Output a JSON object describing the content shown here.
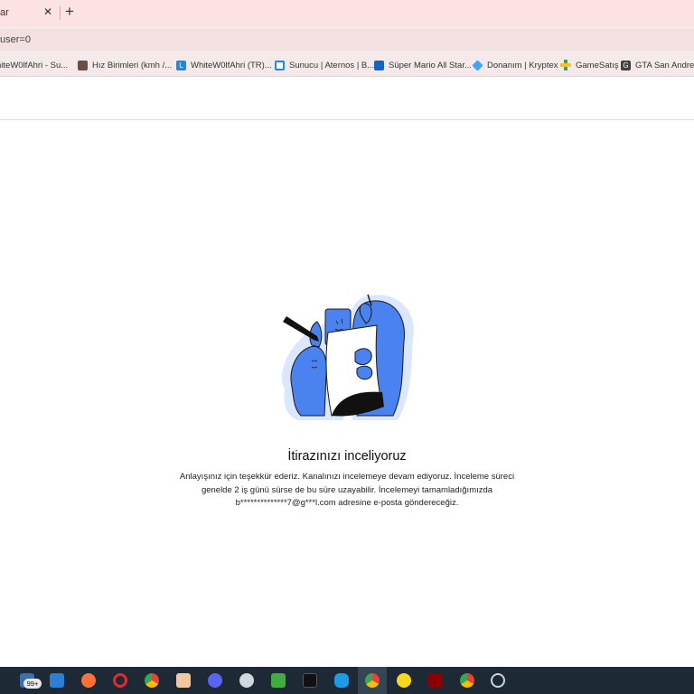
{
  "browser": {
    "tab_title": "ar",
    "tab_close": "✕",
    "new_tab": "+",
    "url": "user=0"
  },
  "bookmarks": [
    {
      "label": "hiteW0lfAhri - Su...",
      "color": "#c62828"
    },
    {
      "label": "Hız Birimleri (kmh /...",
      "color": "#6d4c41"
    },
    {
      "label": "WhiteW0lfAhri (TR)...",
      "color": "#1e88e5",
      "glyph": "L"
    },
    {
      "label": "Sunucu | Aternos | B...",
      "color": "#1e88e5"
    },
    {
      "label": "Süper Mario All Star...",
      "color": "#1565c0"
    },
    {
      "label": "Donanım | Kryptex",
      "color": "#42a5f5"
    },
    {
      "label": "GameSatış",
      "color": "#43a047"
    },
    {
      "label": "GTA San Andreas",
      "color": "#424242",
      "glyph": "G"
    }
  ],
  "page": {
    "heading": "İtirazınızı inceliyoruz",
    "body": "Anlayışınız için teşekkür ederiz. Kanalınızı incelemeye devam ediyoruz. İnceleme süreci genelde 2 iş günü sürse de bu süre uzayabilir. İncelemeyi tamamladığımızda b**************7@g***l.com adresine e-posta göndereceğiz."
  },
  "taskbar": {
    "badge": "99+"
  }
}
